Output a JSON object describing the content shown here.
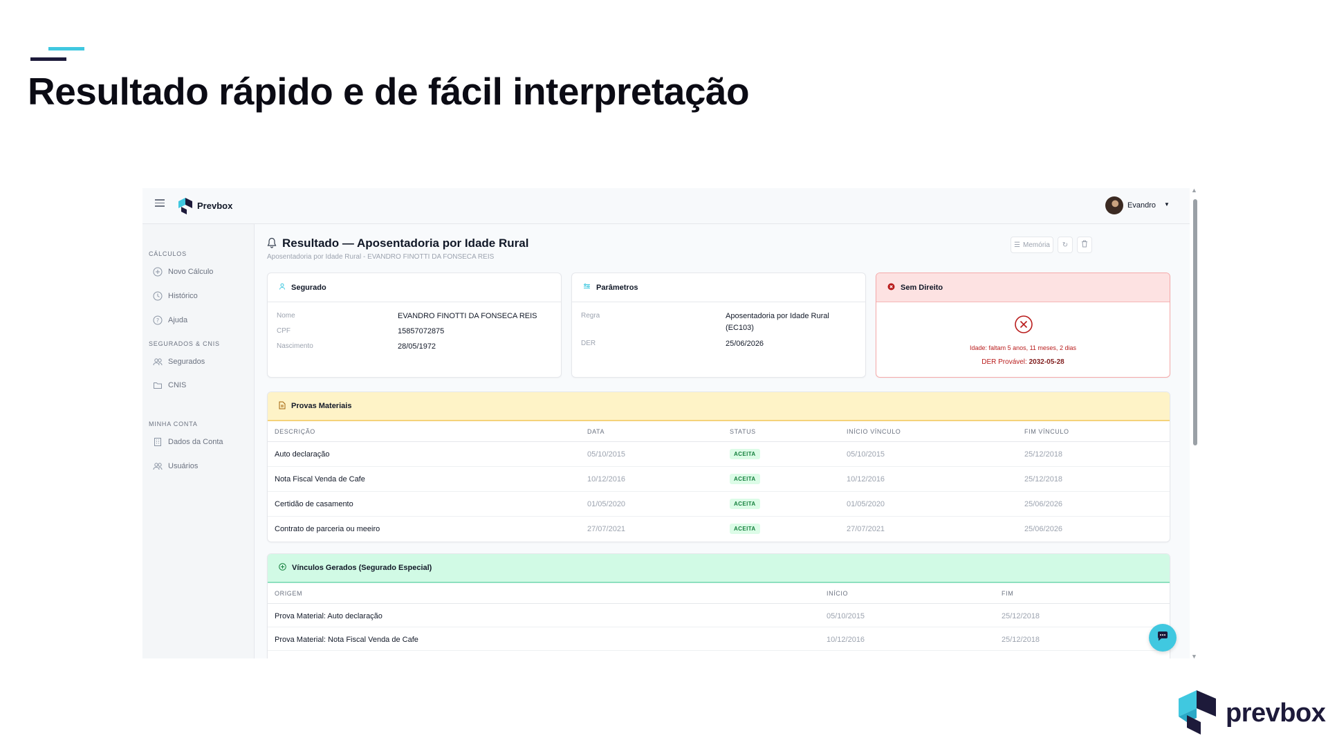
{
  "slide": {
    "title": "Resultado rápido e de fácil interpretação",
    "brand": "prevbox"
  },
  "colors": {
    "accent": "#40c8e0",
    "navy": "#1d1a3a",
    "danger": "#b91c1c",
    "success": "#15803d",
    "warning_bg": "#fef3c7",
    "success_bg": "#d1fae5"
  },
  "app": {
    "name": "Prevbox",
    "user": "Evandro"
  },
  "sidebar": {
    "sections": [
      {
        "title": "CÁLCULOS",
        "items": [
          {
            "label": "Novo Cálculo",
            "icon": "plus-circle-icon"
          },
          {
            "label": "Histórico",
            "icon": "clock-icon"
          },
          {
            "label": "Ajuda",
            "icon": "help-circle-icon"
          }
        ]
      },
      {
        "title": "SEGURADOS & CNIS",
        "items": [
          {
            "label": "Segurados",
            "icon": "users-icon"
          },
          {
            "label": "CNIS",
            "icon": "folder-icon"
          }
        ]
      },
      {
        "title": "MINHA CONTA",
        "items": [
          {
            "label": "Dados da Conta",
            "icon": "building-icon"
          },
          {
            "label": "Usuários",
            "icon": "users-icon"
          }
        ]
      }
    ]
  },
  "page": {
    "title": "Resultado — Aposentadoria por Idade Rural",
    "subtitle": "Aposentadoria por Idade Rural - EVANDRO FINOTTI DA FONSECA REIS",
    "memoria_label": "Memória"
  },
  "segurado": {
    "title": "Segurado",
    "fields": [
      {
        "label": "Nome",
        "value": "EVANDRO FINOTTI DA FONSECA REIS"
      },
      {
        "label": "CPF",
        "value": "15857072875"
      },
      {
        "label": "Nascimento",
        "value": "28/05/1972"
      }
    ]
  },
  "parametros": {
    "title": "Parâmetros",
    "regra_label": "Regra",
    "regra_line1": "Aposentadoria por Idade Rural",
    "regra_line2": "(EC103)",
    "der_label": "DER",
    "der_value": "25/06/2026"
  },
  "resultado": {
    "title": "Sem Direito",
    "detail": "Idade: faltam 5 anos, 11 meses, 2 dias",
    "der_label": "DER Provável:",
    "der_value": "2032-05-28"
  },
  "provas": {
    "title": "Provas Materiais",
    "columns": [
      "DESCRIÇÃO",
      "DATA",
      "STATUS",
      "INÍCIO VÍNCULO",
      "FIM VÍNCULO"
    ],
    "rows": [
      {
        "descricao": "Auto declaração",
        "data": "05/10/2015",
        "status": "ACEITA",
        "inicio": "05/10/2015",
        "fim": "25/12/2018"
      },
      {
        "descricao": "Nota Fiscal Venda de Cafe",
        "data": "10/12/2016",
        "status": "ACEITA",
        "inicio": "10/12/2016",
        "fim": "25/12/2018"
      },
      {
        "descricao": "Certidão de casamento",
        "data": "01/05/2020",
        "status": "ACEITA",
        "inicio": "01/05/2020",
        "fim": "25/06/2026"
      },
      {
        "descricao": "Contrato de parceria ou meeiro",
        "data": "27/07/2021",
        "status": "ACEITA",
        "inicio": "27/07/2021",
        "fim": "25/06/2026"
      }
    ]
  },
  "vinculos": {
    "title": "Vínculos Gerados (Segurado Especial)",
    "columns": [
      "ORIGEM",
      "INÍCIO",
      "FIM"
    ],
    "rows": [
      {
        "origem": "Prova Material: Auto declaração",
        "inicio": "05/10/2015",
        "fim": "25/12/2018"
      },
      {
        "origem": "Prova Material: Nota Fiscal Venda de Cafe",
        "inicio": "10/12/2016",
        "fim": "25/12/2018"
      }
    ]
  }
}
